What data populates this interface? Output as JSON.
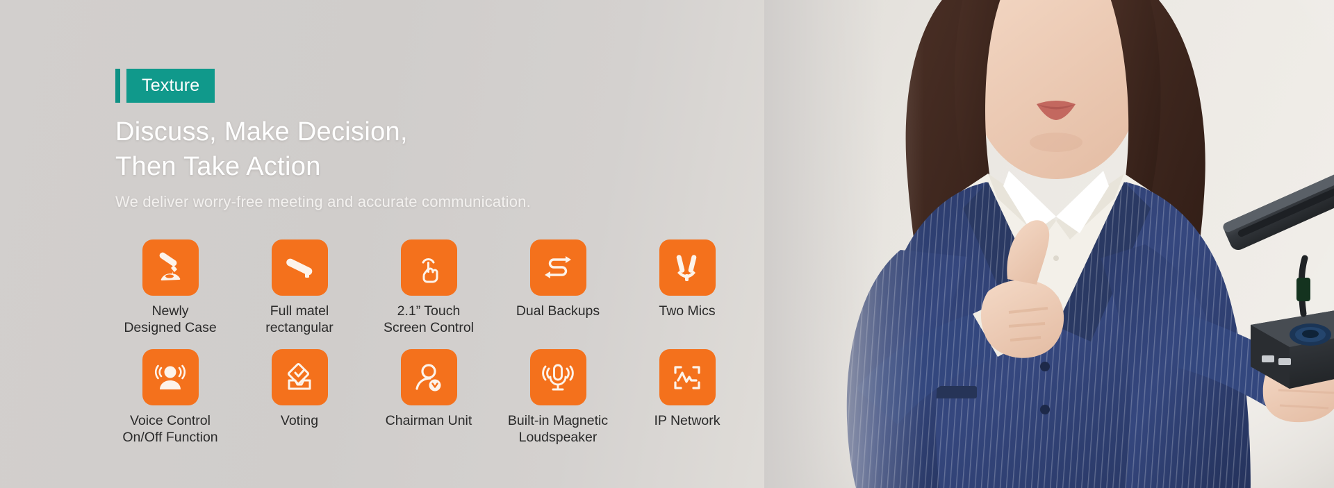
{
  "banner": {
    "eyebrow": "Texture",
    "headline_line1": "Discuss, Make Decision,",
    "headline_line2": "Then Take Action",
    "subheadline": "We deliver worry-free meeting and accurate communication.",
    "colors": {
      "accent_teal": "#10998b",
      "accent_teal_bar": "#0e9184",
      "icon_orange": "#f4711c",
      "headline_white": "#ffffff",
      "label_dark": "#2a2a2a",
      "background_grey": "#d2cfcd"
    }
  },
  "features": {
    "row1": [
      {
        "icon": "conference-microphone-icon",
        "label": "Newly\nDesigned Case"
      },
      {
        "icon": "metal-bar-icon",
        "label": "Full matel\nrectangular"
      },
      {
        "icon": "touch-hand-icon",
        "label": "2.1” Touch\nScreen Control"
      },
      {
        "icon": "dual-backup-arrows-icon",
        "label": "Dual Backups"
      },
      {
        "icon": "two-mics-icon",
        "label": "Two Mics"
      }
    ],
    "row2": [
      {
        "icon": "voice-control-person-icon",
        "label": "Voice Control\nOn/Off Function"
      },
      {
        "icon": "voting-ballot-icon",
        "label": "Voting"
      },
      {
        "icon": "chairman-person-badge-icon",
        "label": "Chairman Unit"
      },
      {
        "icon": "magnetic-loudspeaker-mic-icon",
        "label": "Built-in Magnetic\nLoudspeaker"
      },
      {
        "icon": "ip-network-waveform-icon",
        "label": "IP Network"
      }
    ]
  },
  "photo": {
    "description": "businesswoman-holding-conference-microphone-unit",
    "suit_color": "#2e3f73",
    "shirt_color": "#f2efe8",
    "device_color": "#2f3236"
  }
}
